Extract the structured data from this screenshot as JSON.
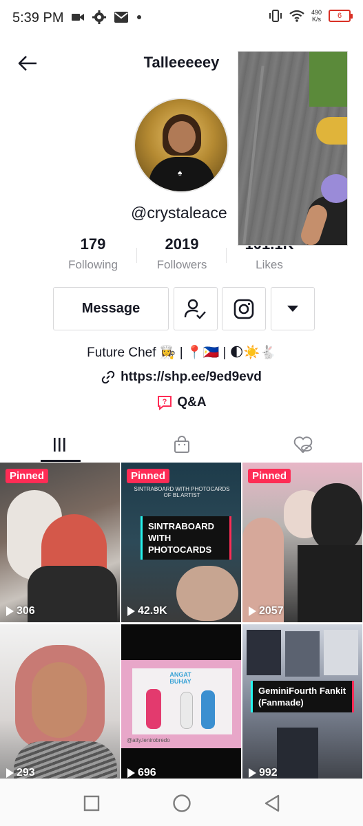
{
  "status_bar": {
    "time": "5:39 PM",
    "net_speed_value": "490",
    "net_speed_unit": "K/s",
    "battery": "6"
  },
  "header": {
    "title": "Talleeeeey"
  },
  "profile": {
    "handle": "@crystaleace",
    "stats": [
      {
        "value": "179",
        "label": "Following"
      },
      {
        "value": "2019",
        "label": "Followers"
      },
      {
        "value": "101.1K",
        "label": "Likes"
      }
    ],
    "message_label": "Message",
    "bio": "Future Chef 👩‍🍳 | 📍🇵🇭 | 🌓☀️🐇",
    "link": "https://shp.ee/9ed9evd",
    "qa_label": "Q&A"
  },
  "grid": {
    "videos": [
      {
        "pinned": "Pinned",
        "views": "306"
      },
      {
        "pinned": "Pinned",
        "views": "42.9K",
        "overlay_top": "SINTRABOARD WITH PHOTOCARDS OF BL ARTIST",
        "caption": "SINTRABOARD WITH PHOTOCARDS"
      },
      {
        "pinned": "Pinned",
        "views": "2057"
      },
      {
        "views": "293"
      },
      {
        "views": "696",
        "overlay_top": "ANGAT BUHAY",
        "watermark": "@atty.lenirobredo"
      },
      {
        "views": "992",
        "caption": "GeminiFourth Fankit (Fanmade)"
      }
    ]
  },
  "colors": {
    "accent": "#fe2c55",
    "cyan": "#25f4ee",
    "text": "#161823",
    "muted": "#8a8b91"
  }
}
